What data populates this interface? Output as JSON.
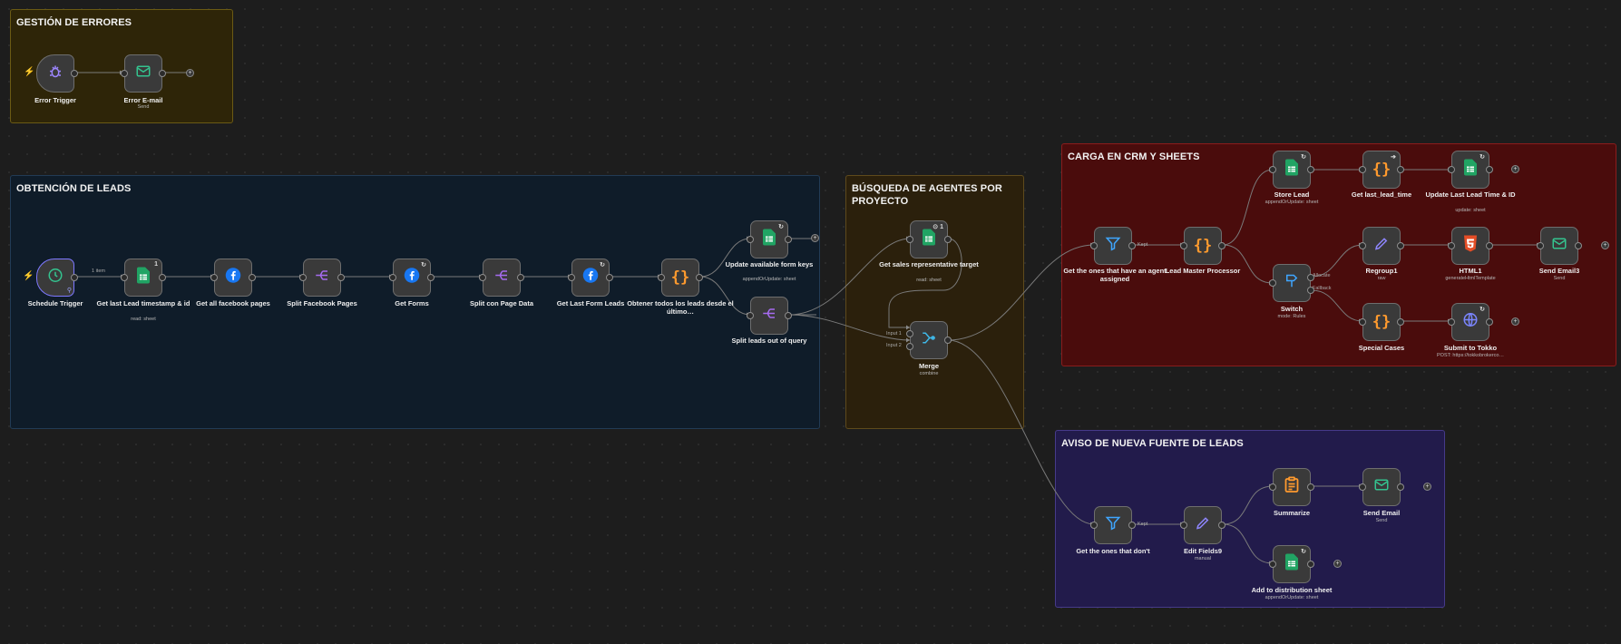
{
  "groups": {
    "errores": "GESTIÓN DE ERRORES",
    "obtencion": "OBTENCIÓN DE LEADS",
    "busqueda": "BÚSQUEDA DE AGENTES POR PROYECTO",
    "carga": "CARGA EN CRM Y SHEETS",
    "aviso": "AVISO DE NUEVA FUENTE DE LEADS"
  },
  "colors": {
    "errores_fill": "#2e2508",
    "errores_border": "#6b5a14",
    "obtencion_fill": "#0f1c29",
    "obtencion_border": "#223b55",
    "busqueda_fill": "#2b200c",
    "busqueda_border": "#5e4a1c",
    "carga_fill": "#4a0c0c",
    "carga_border": "#8a1c1c",
    "aviso_fill": "#221b4b",
    "aviso_border": "#463a8a",
    "wire": "#7a7a7a",
    "selected": "#7d78ff"
  },
  "nodes": {
    "error_trigger": {
      "label": "Error Trigger",
      "icon": "bug-icon"
    },
    "error_email": {
      "label": "Error E-mail",
      "sub": "Send",
      "icon": "email-icon"
    },
    "schedule_trigger": {
      "label": "Schedule Trigger",
      "icon": "clock-icon"
    },
    "get_last_lead": {
      "label": "Get last Lead timestamp & id",
      "sub": "read: sheet",
      "icon": "google-sheets-icon",
      "badge": "1"
    },
    "get_fb_pages": {
      "label": "Get all facebook pages",
      "icon": "facebook-icon"
    },
    "split_fb_pages": {
      "label": "Split Facebook Pages",
      "icon": "split-icon"
    },
    "get_forms": {
      "label": "Get Forms",
      "icon": "facebook-icon"
    },
    "split_page_data": {
      "label": "Split con Page Data",
      "icon": "split-icon"
    },
    "get_last_form_leads": {
      "label": "Get Last Form Leads",
      "icon": "facebook-icon"
    },
    "obtener_leads": {
      "label": "Obtener todos los leads desde el último…",
      "icon": "code-icon"
    },
    "update_form_keys": {
      "label": "Update available form keys",
      "sub": "appendOrUpdate: sheet",
      "icon": "google-sheets-icon"
    },
    "split_leads_query": {
      "label": "Split leads out of query",
      "icon": "split-icon"
    },
    "get_sales_rep": {
      "label": "Get sales representative target",
      "sub": "read: sheet",
      "icon": "google-sheets-icon",
      "badge": "1"
    },
    "merge": {
      "label": "Merge",
      "sub": "combine",
      "icon": "merge-icon"
    },
    "filter_assigned": {
      "label": "Get the ones that have an agent assigned",
      "icon": "filter-icon"
    },
    "lead_master": {
      "label": "Lead Master Processor",
      "icon": "code-icon"
    },
    "store_lead": {
      "label": "Store Lead",
      "sub": "appendOrUpdate: sheet",
      "icon": "google-sheets-icon"
    },
    "get_last_lead_time": {
      "label": "Get last_lead_time",
      "icon": "code-icon"
    },
    "update_last_lead_time": {
      "label": "Update Last Lead Time & ID",
      "sub": "update: sheet",
      "icon": "google-sheets-icon"
    },
    "switch": {
      "label": "Switch",
      "sub": "mode: Rules",
      "icon": "switch-icon"
    },
    "regroup1": {
      "label": "Regroup1",
      "sub": "raw",
      "icon": "pencil-icon"
    },
    "html1": {
      "label": "HTML1",
      "sub": "generateHtmlTemplate",
      "icon": "html5-icon"
    },
    "send_email3": {
      "label": "Send Email3",
      "sub": "Send",
      "icon": "email-icon"
    },
    "special_cases": {
      "label": "Special Cases",
      "icon": "code-icon"
    },
    "submit_tokko": {
      "label": "Submit to Tokko",
      "sub": "POST: https://tokkobrokerco…",
      "icon": "globe-icon"
    },
    "filter_dont": {
      "label": "Get the ones that don't",
      "icon": "filter-icon"
    },
    "edit_fields9": {
      "label": "Edit Fields9",
      "sub": "manual",
      "icon": "pencil-icon"
    },
    "summarize": {
      "label": "Summarize",
      "icon": "summarize-icon"
    },
    "send_email": {
      "label": "Send Email",
      "sub": "Send",
      "icon": "email-icon"
    },
    "add_distribution": {
      "label": "Add to distribution sheet",
      "sub": "appendOrUpdate: sheet",
      "icon": "google-sheets-icon"
    }
  },
  "edge_labels": {
    "item_count": "1 item",
    "input1": "Input 1",
    "input2": "Input 2",
    "kept_assigned": "Kept",
    "kept_dont": "Kept",
    "switch_out1": "Allocate",
    "switch_fallback": "Fallback"
  }
}
